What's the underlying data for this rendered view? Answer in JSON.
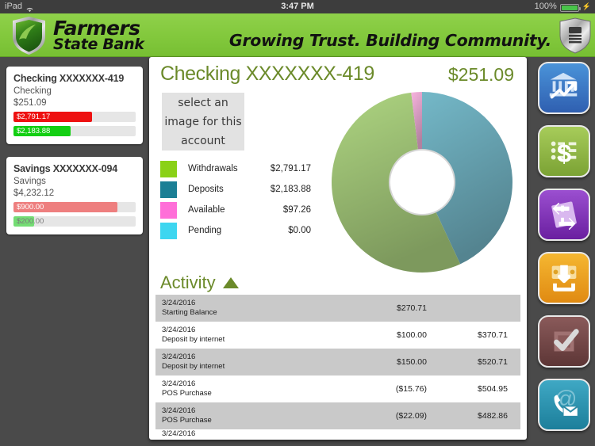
{
  "statusbar": {
    "device": "iPad",
    "wifi_icon": "wifi-icon",
    "time": "3:47 PM",
    "battery_percent": "100%",
    "battery_icon": "battery-charging-icon"
  },
  "header": {
    "brand_line1": "Farmers",
    "brand_line2": "State Bank",
    "tagline": "Growing Trust. Building Community.",
    "logo_icon": "shield-logo-icon",
    "secure_icon": "shield-lock-icon",
    "bar_color": "#82c83c"
  },
  "sidebar": {
    "accounts": [
      {
        "title": "Checking XXXXXXX-419",
        "type": "Checking",
        "balance": "$251.09",
        "bars": [
          {
            "label": "$2,791.17",
            "color": "#ee1111",
            "fill_pct": 64,
            "label_color": "light"
          },
          {
            "label": "$2,183.88",
            "color": "#13cf13",
            "fill_pct": 47,
            "label_color": "light"
          }
        ]
      },
      {
        "title": "Savings XXXXXXX-094",
        "type": "Savings",
        "balance": "$4,232.12",
        "bars": [
          {
            "label": "$900.00",
            "color": "#ee7f7f",
            "fill_pct": 85,
            "label_color": "light"
          },
          {
            "label": "$200.00",
            "color": "#74dd74",
            "fill_pct": 17,
            "label_color": "dark"
          }
        ]
      }
    ]
  },
  "main": {
    "account_heading": "Checking XXXXXXX-419",
    "account_amount": "$251.09",
    "image_placeholder": "select an image for this account",
    "activity_title": "Activity",
    "activity_sort_icon": "triangle-up-icon",
    "accent_color": "#6b8a2a"
  },
  "chart_data": {
    "type": "pie",
    "title": "Checking XXXXXXX-419",
    "legend_position": "left",
    "categories": [
      "Withdrawals",
      "Deposits",
      "Available",
      "Pending"
    ],
    "values": [
      2791.17,
      2183.88,
      97.26,
      0.0
    ],
    "value_labels": [
      "$2,791.17",
      "$2,183.88",
      "$97.26",
      "$0.00"
    ],
    "legend_colors": [
      "#8ad117",
      "#1b7f95",
      "#ff6fd8",
      "#3dd6f0"
    ],
    "slice_colors": [
      "#aed581",
      "#74b8c8",
      "#f7b3de",
      "#8fe3f2"
    ],
    "donut_inner_ratio": 0.36
  },
  "activity": {
    "rows": [
      {
        "date": "3/24/2016",
        "desc": "Starting Balance",
        "amount": "$270.71",
        "balance": ""
      },
      {
        "date": "3/24/2016",
        "desc": "Deposit by internet",
        "amount": "$100.00",
        "balance": "$370.71"
      },
      {
        "date": "3/24/2016",
        "desc": "Deposit by internet",
        "amount": "$150.00",
        "balance": "$520.71"
      },
      {
        "date": "3/24/2016",
        "desc": "POS Purchase",
        "amount": "($15.76)",
        "balance": "$504.95"
      },
      {
        "date": "3/24/2016",
        "desc": "POS Purchase",
        "amount": "($22.09)",
        "balance": "$482.86"
      },
      {
        "date": "3/24/2016",
        "desc": "",
        "amount": "",
        "balance": ""
      }
    ]
  },
  "rail": {
    "buttons": [
      {
        "name": "accounts-button",
        "icon": "bank-chart-icon",
        "color_top": "#4a93d9",
        "color_bottom": "#2f5fb0"
      },
      {
        "name": "billpay-button",
        "icon": "dollar-list-icon",
        "color_top": "#a7cc5a",
        "color_bottom": "#7ba234"
      },
      {
        "name": "transfers-button",
        "icon": "transfer-arrows-icon",
        "color_top": "#9b4fd0",
        "color_bottom": "#6a1fa0"
      },
      {
        "name": "deposit-button",
        "icon": "deposit-money-icon",
        "color_top": "#f5b731",
        "color_bottom": "#e08a12"
      },
      {
        "name": "approvals-button",
        "icon": "checkmark-box-icon",
        "color_top": "#8a5a5a",
        "color_bottom": "#5d3636"
      },
      {
        "name": "contact-button",
        "icon": "phone-mail-icon",
        "color_top": "#3fa8c4",
        "color_bottom": "#1c7f9b"
      }
    ]
  }
}
